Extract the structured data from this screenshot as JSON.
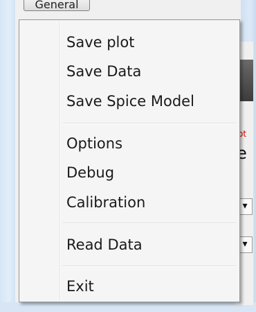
{
  "background": {
    "top_button_label": "General",
    "side_red_text": "ot",
    "side_text": "e",
    "dropdown_glyph": "▾"
  },
  "menu": {
    "groups": [
      [
        "Save plot",
        "Save Data",
        "Save Spice Model"
      ],
      [
        "Options",
        "Debug",
        "Calibration"
      ],
      [
        "Read Data"
      ],
      [
        "Exit"
      ]
    ]
  },
  "colors": {
    "frame": "#d6e6f7",
    "menu_background": "#f5f5f5",
    "menu_border": "#979797"
  }
}
